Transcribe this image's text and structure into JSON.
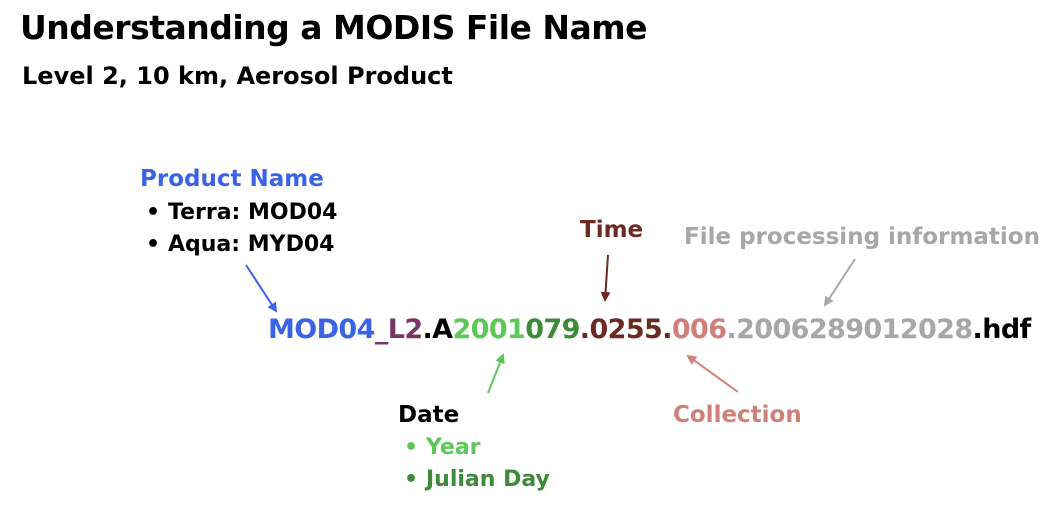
{
  "title": "Understanding a MODIS File Name",
  "subtitle": "Level 2, 10 km, Aerosol Product",
  "colors": {
    "product": "#3b63e6",
    "level": "#7a3562",
    "year": "#5cc85a",
    "day": "#3f8a3a",
    "time": "#6b2a23",
    "collection": "#d07f79",
    "processing": "#a7a7a7",
    "text": "#000000"
  },
  "product_name": {
    "heading": "Product Name",
    "items": [
      "Terra: MOD04",
      "Aqua: MYD04"
    ]
  },
  "time": {
    "label": "Time"
  },
  "file_processing": {
    "label": "File processing information"
  },
  "date": {
    "heading": "Date",
    "items": [
      "Year",
      "Julian Day"
    ]
  },
  "collection": {
    "label": "Collection"
  },
  "filename": {
    "product": "MOD04",
    "sep1": "_",
    "level": "L2",
    "sep2": ".A",
    "year": "2001",
    "day": "079",
    "sep3": ".",
    "time": "0255",
    "sep4": ".",
    "collection": "006",
    "sep5": ".",
    "processing": "2006289012028",
    "ext": ".hdf"
  }
}
